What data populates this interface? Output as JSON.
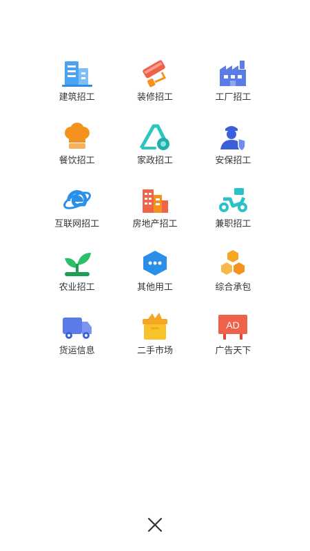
{
  "menu": {
    "items": [
      {
        "label": "建筑招工",
        "icon": "building-icon",
        "color": "#4aa3f0"
      },
      {
        "label": "装修招工",
        "icon": "paint-roller-icon",
        "color": "#f0614a"
      },
      {
        "label": "工厂招工",
        "icon": "factory-icon",
        "color": "#5a7be8"
      },
      {
        "label": "餐饮招工",
        "icon": "chef-hat-icon",
        "color": "#f5921e"
      },
      {
        "label": "家政招工",
        "icon": "vacuum-cleaner-icon",
        "color": "#2cc5c0"
      },
      {
        "label": "安保招工",
        "icon": "security-guard-icon",
        "color": "#3a5fd9"
      },
      {
        "label": "互联网招工",
        "icon": "internet-explorer-icon",
        "color": "#2a8fe8"
      },
      {
        "label": "房地产招工",
        "icon": "real-estate-icon",
        "color": "#f0654a"
      },
      {
        "label": "兼职招工",
        "icon": "scooter-icon",
        "color": "#2cc0c8"
      },
      {
        "label": "农业招工",
        "icon": "sprout-icon",
        "color": "#2cbf6a"
      },
      {
        "label": "其他用工",
        "icon": "more-dots-icon",
        "color": "#2a8fe8"
      },
      {
        "label": "综合承包",
        "icon": "hexagon-cluster-icon",
        "color": "#f5a623"
      },
      {
        "label": "货运信息",
        "icon": "truck-icon",
        "color": "#5a7be8"
      },
      {
        "label": "二手市场",
        "icon": "shopping-box-icon",
        "color": "#f7c22a"
      },
      {
        "label": "广告天下",
        "icon": "ad-board-icon",
        "color": "#f0614a"
      }
    ]
  },
  "close": {
    "icon": "close-icon"
  }
}
